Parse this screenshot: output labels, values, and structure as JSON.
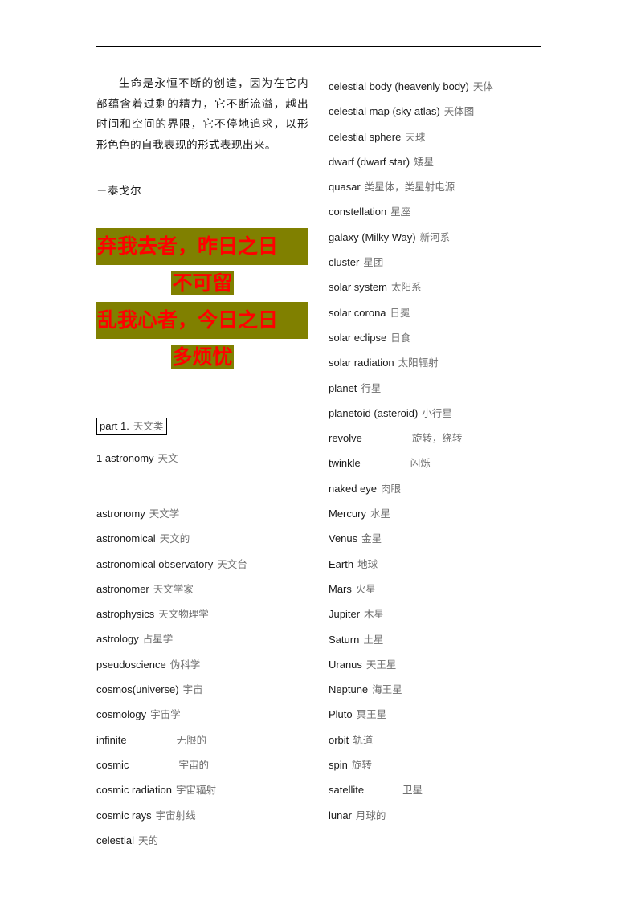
{
  "document": {
    "background_color": "#ffffff",
    "rule_color": "#000000",
    "highlight_color": "#808000",
    "highlight_text_color": "#ff0000",
    "english_text_color": "#1a1a1a",
    "chinese_text_color": "#6e6e6e"
  },
  "epigraph": {
    "text": "生命是永恒不断的创造，因为在它内部蕴含着过剩的精力，它不断流溢，越出时间和空间的界限，它不停地追求，以形形色色的自我表现的形式表现出来。",
    "attribution": "－泰戈尔"
  },
  "poem": {
    "lines": [
      {
        "text": "弃我去者，昨日之日",
        "full_width": true
      },
      {
        "text": "不可留",
        "full_width": false
      },
      {
        "text": "乱我心者，今日之日",
        "full_width": true
      },
      {
        "text": "多烦忧",
        "full_width": false
      }
    ]
  },
  "section": {
    "part_label_en": "part 1.",
    "part_label_cn": "天文类",
    "subhead_en": "1 astronomy",
    "subhead_cn": "天文"
  },
  "left_column": {
    "entries": [
      {
        "en": "astronomy",
        "cn": "天文学",
        "gap": "small"
      },
      {
        "en": "astronomical",
        "cn": "天文的",
        "gap": "small"
      },
      {
        "en": "astronomical observatory",
        "cn": "天文台",
        "gap": "small"
      },
      {
        "en": "astronomer",
        "cn": "天文学家",
        "gap": "small"
      },
      {
        "en": "astrophysics",
        "cn": "天文物理学",
        "gap": "small"
      },
      {
        "en": "astrology",
        "cn": "占星学",
        "gap": "small"
      },
      {
        "en": "pseudoscience",
        "cn": "伪科学",
        "gap": "small"
      },
      {
        "en": "cosmos(universe)",
        "cn": "宇宙",
        "gap": "small"
      },
      {
        "en": "cosmology",
        "cn": "宇宙学",
        "gap": "small"
      },
      {
        "en": "infinite",
        "cn": "无限的",
        "gap": "wide"
      },
      {
        "en": "cosmic",
        "cn": "宇宙的",
        "gap": "wide"
      },
      {
        "en": "cosmic radiation",
        "cn": "宇宙辐射",
        "gap": "small"
      },
      {
        "en": "cosmic rays",
        "cn": "宇宙射线",
        "gap": "small"
      },
      {
        "en": "celestial",
        "cn": "天的",
        "gap": "small"
      }
    ]
  },
  "right_column": {
    "entries": [
      {
        "en": "celestial body (heavenly body)",
        "cn": "天体",
        "gap": "small"
      },
      {
        "en": "celestial map (sky atlas)",
        "cn": "天体图",
        "gap": "small"
      },
      {
        "en": "celestial sphere",
        "cn": "天球",
        "gap": "small"
      },
      {
        "en": "dwarf (dwarf star)",
        "cn": "矮星",
        "gap": "small"
      },
      {
        "en": "quasar",
        "cn": "类星体，类星射电源",
        "gap": "small"
      },
      {
        "en": "constellation",
        "cn": "星座",
        "gap": "small"
      },
      {
        "en": "galaxy (Milky Way)",
        "cn": "新河系",
        "gap": "small"
      },
      {
        "en": "cluster",
        "cn": "星团",
        "gap": "small"
      },
      {
        "en": "solar system",
        "cn": "太阳系",
        "gap": "small"
      },
      {
        "en": "solar corona",
        "cn": "日冕",
        "gap": "small"
      },
      {
        "en": "solar eclipse",
        "cn": "日食",
        "gap": "small"
      },
      {
        "en": "solar radiation",
        "cn": "太阳辐射",
        "gap": "small"
      },
      {
        "en": "planet",
        "cn": "行星",
        "gap": "small"
      },
      {
        "en": "planetoid (asteroid)",
        "cn": "小行星",
        "gap": "small"
      },
      {
        "en": "revolve",
        "cn": "旋转，绕转",
        "gap": "wide"
      },
      {
        "en": "twinkle",
        "cn": "闪烁",
        "gap": "wide"
      },
      {
        "en": "naked eye",
        "cn": "肉眼",
        "gap": "small"
      },
      {
        "en": "Mercury",
        "cn": "水星",
        "gap": "small"
      },
      {
        "en": "Venus",
        "cn": "金星",
        "gap": "small"
      },
      {
        "en": "Earth",
        "cn": "地球",
        "gap": "small"
      },
      {
        "en": "Mars",
        "cn": "火星",
        "gap": "small"
      },
      {
        "en": "Jupiter",
        "cn": "木星",
        "gap": "small"
      },
      {
        "en": "Saturn",
        "cn": "土星",
        "gap": "small"
      },
      {
        "en": "Uranus",
        "cn": "天王星",
        "gap": "small"
      },
      {
        "en": "Neptune",
        "cn": "海王星",
        "gap": "small"
      },
      {
        "en": "Pluto",
        "cn": "冥王星",
        "gap": "small"
      },
      {
        "en": "orbit",
        "cn": "轨道",
        "gap": "small"
      },
      {
        "en": "spin",
        "cn": "旋转",
        "gap": "small"
      },
      {
        "en": "satellite",
        "cn": "卫星",
        "gap": "medium"
      },
      {
        "en": "lunar",
        "cn": "月球的",
        "gap": "small"
      }
    ]
  }
}
